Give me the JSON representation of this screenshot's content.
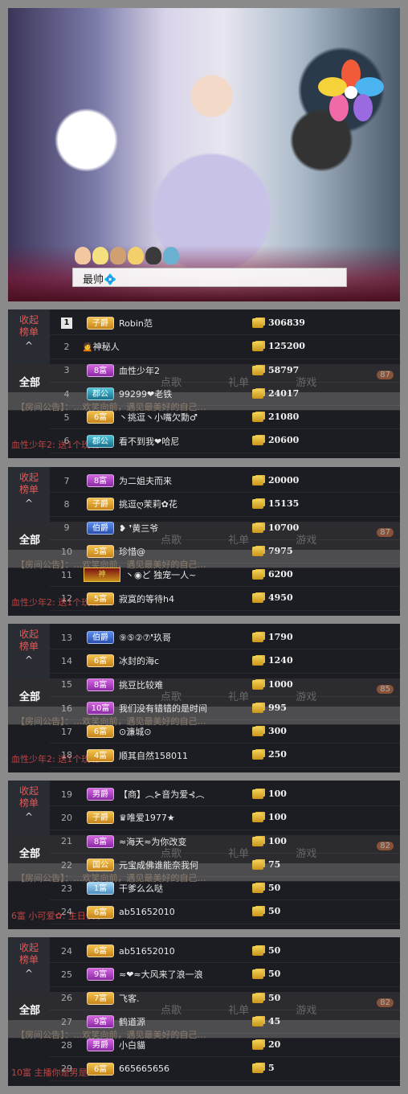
{
  "stream": {
    "chat_bubble": "最帅💠"
  },
  "panel_ui": {
    "collapse_label": "收起\n榜单",
    "all_label": "全部",
    "tabs": [
      "点歌",
      "礼单",
      "游戏"
    ],
    "notice": "【房间公告】：…欢笑向前，遇见最美好的自己…"
  },
  "panels": [
    {
      "badge": "87",
      "chatline": "血性少年2: 送1个玫瑰",
      "rows": [
        {
          "rank": "1",
          "level": "子爵",
          "lvclass": "gold",
          "name": "Robin范",
          "score": "306839",
          "top": true
        },
        {
          "rank": "2",
          "level": "",
          "lvclass": "none",
          "name": "🙍神秘人",
          "score": "125200"
        },
        {
          "rank": "3",
          "level": "8富",
          "lvclass": "purple",
          "name": "血性少年2",
          "score": "58797"
        },
        {
          "rank": "4",
          "level": "郡公",
          "lvclass": "teal",
          "name": "99299❤老铁",
          "score": "24017"
        },
        {
          "rank": "5",
          "level": "6富",
          "lvclass": "gold",
          "name": "丶挑逗丶小嘴欠勳♂",
          "score": "21080"
        },
        {
          "rank": "6",
          "level": "郡公",
          "lvclass": "teal",
          "name": "看不到我❤哈尼",
          "score": "20600"
        }
      ]
    },
    {
      "badge": "87",
      "chatline": "血性少年2: 送1个玫瑰",
      "rows": [
        {
          "rank": "7",
          "level": "8富",
          "lvclass": "purple",
          "name": "为二姐夫而来",
          "score": "20000"
        },
        {
          "rank": "8",
          "level": "子爵",
          "lvclass": "gold",
          "name": "挑逗ღ茉莉✿花",
          "score": "15135"
        },
        {
          "rank": "9",
          "level": "伯爵",
          "lvclass": "blue",
          "name": "❥ ❜黄三爷",
          "score": "10700"
        },
        {
          "rank": "10",
          "level": "5富",
          "lvclass": "gold",
          "name": "珍惜@",
          "score": "7975"
        },
        {
          "rank": "11",
          "level": "",
          "lvclass": "none",
          "crown": "神",
          "name": "丶◉ど 独宠一人~",
          "score": "6200"
        },
        {
          "rank": "12",
          "level": "5富",
          "lvclass": "gold",
          "name": "寂寞的等待h4",
          "score": "4950"
        }
      ]
    },
    {
      "badge": "85",
      "chatline": "血性少年2: 送1个玫瑰",
      "rows": [
        {
          "rank": "13",
          "level": "伯爵",
          "lvclass": "blue",
          "name": "⑨⑤②⑦❜玖哥",
          "score": "1790"
        },
        {
          "rank": "14",
          "level": "6富",
          "lvclass": "gold",
          "name": "冰封的海c",
          "score": "1240"
        },
        {
          "rank": "15",
          "level": "8富",
          "lvclass": "purple",
          "name": "挑豆比较难",
          "score": "1000"
        },
        {
          "rank": "16",
          "level": "10富",
          "lvclass": "purple",
          "name": "我们没有错错的是时间",
          "score": "995"
        },
        {
          "rank": "17",
          "level": "6富",
          "lvclass": "gold",
          "name": "⊙濂城⊙",
          "score": "300"
        },
        {
          "rank": "18",
          "level": "4富",
          "lvclass": "gold",
          "name": "顺其自然158011",
          "score": "250"
        }
      ]
    },
    {
      "badge": "82",
      "chatline": "6富 小可爱✿: 主日快乐",
      "rows": [
        {
          "rank": "19",
          "level": "男爵",
          "lvclass": "purple",
          "name": "【商】︵⊱音为爱⊰︵",
          "score": "100"
        },
        {
          "rank": "20",
          "level": "子爵",
          "lvclass": "gold",
          "name": "♛唯爱1977★",
          "score": "100"
        },
        {
          "rank": "21",
          "level": "8富",
          "lvclass": "purple",
          "name": "≈海天≈为你改变",
          "score": "100"
        },
        {
          "rank": "22",
          "level": "国公",
          "lvclass": "gold",
          "name": "元宝成佛谁能奈我何",
          "score": "75"
        },
        {
          "rank": "23",
          "level": "1富",
          "lvclass": "light",
          "name": "干爹么么哒",
          "score": "50"
        },
        {
          "rank": "24",
          "level": "6富",
          "lvclass": "gold",
          "name": "ab51652010",
          "score": "50"
        }
      ]
    },
    {
      "badge": "82",
      "chatline": "10富 主播你是男是人…",
      "rows": [
        {
          "rank": "24",
          "level": "6富",
          "lvclass": "gold",
          "name": "ab51652010",
          "score": "50"
        },
        {
          "rank": "25",
          "level": "9富",
          "lvclass": "purple",
          "name": "≈❤≈大风来了浪一浪",
          "score": "50"
        },
        {
          "rank": "26",
          "level": "7富",
          "lvclass": "gold",
          "name": "飞客.",
          "score": "50"
        },
        {
          "rank": "27",
          "level": "9富",
          "lvclass": "purple",
          "name": "鹤道源",
          "score": "45"
        },
        {
          "rank": "28",
          "level": "男爵",
          "lvclass": "purple",
          "name": "小白貓",
          "score": "20"
        },
        {
          "rank": "29",
          "level": "6富",
          "lvclass": "gold",
          "name": "665665656",
          "score": "5"
        }
      ]
    }
  ]
}
